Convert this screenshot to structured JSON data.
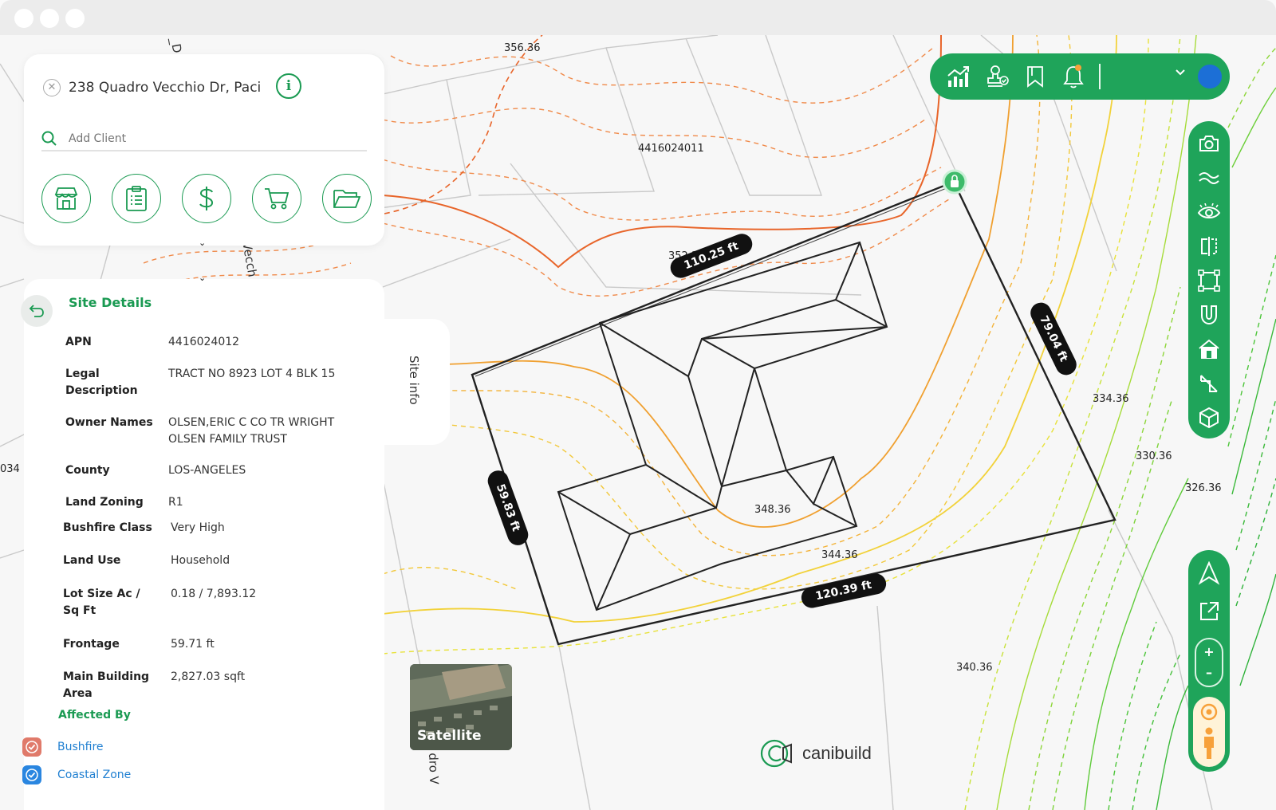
{
  "address": {
    "text": "238 Quadro Vecchio Dr, Paci",
    "client_placeholder": "Add Client"
  },
  "map": {
    "elevations": [
      "356.36",
      "352.36",
      "348.36",
      "344.36",
      "340.36",
      "334.36",
      "330.36",
      "326.36"
    ],
    "parcels": [
      "4416024011"
    ],
    "dimensions": [
      "110.25 ft",
      "79.04 ft",
      "59.83 ft",
      "120.39 ft"
    ],
    "street_fragments": [
      "Vecch",
      "dro V",
      "034",
      "_D"
    ],
    "satellite_label": "Satellite",
    "brand": "canibuild"
  },
  "site_details": {
    "title": "Site Details",
    "tab_label": "Site info",
    "rows": [
      {
        "label": "APN",
        "value": "4416024012"
      },
      {
        "label": "Legal Description",
        "value": "TRACT NO 8923 LOT 4 BLK 15"
      },
      {
        "label": "Owner Names",
        "value": "OLSEN,ERIC C CO TR WRIGHT OLSEN FAMILY TRUST"
      },
      {
        "label": "County",
        "value": "LOS-ANGELES"
      },
      {
        "label": "Land Zoning",
        "value": "R1"
      },
      {
        "label": "Bushfire Class",
        "value": "Very High"
      },
      {
        "label": "Land Use",
        "value": "Household"
      },
      {
        "label": "Lot Size Ac / Sq Ft",
        "value": "0.18 / 7,893.12"
      },
      {
        "label": "Frontage",
        "value": "59.71 ft"
      },
      {
        "label": "Main Building Area",
        "value": "2,827.03 sqft"
      }
    ],
    "affected_title": "Affected By",
    "affected": [
      {
        "label": "Bushfire",
        "color": "#e07a6a"
      },
      {
        "label": "Coastal Zone",
        "color": "#2a86e0"
      }
    ]
  },
  "colors": {
    "brand": "#1fa45a",
    "accent_text": "#1a9a52",
    "link": "#1f7fd1"
  },
  "top_toolbar_icons": [
    "chart-icon",
    "stamp-icon",
    "bookmark-icon",
    "bell-icon",
    "chevron-down-icon",
    "avatar"
  ],
  "right_toolbar_icons": [
    "camera-icon",
    "waves-icon",
    "eye-icon",
    "mirror-icon",
    "frame-icon",
    "magnet-icon",
    "house-icon",
    "measure-icon",
    "cube-icon"
  ],
  "nav_toolbar_icons": [
    "compass-icon",
    "external-link-icon",
    "zoom-in",
    "zoom-out",
    "pegman-icon"
  ],
  "zoom": {
    "plus": "+",
    "minus": "–"
  }
}
